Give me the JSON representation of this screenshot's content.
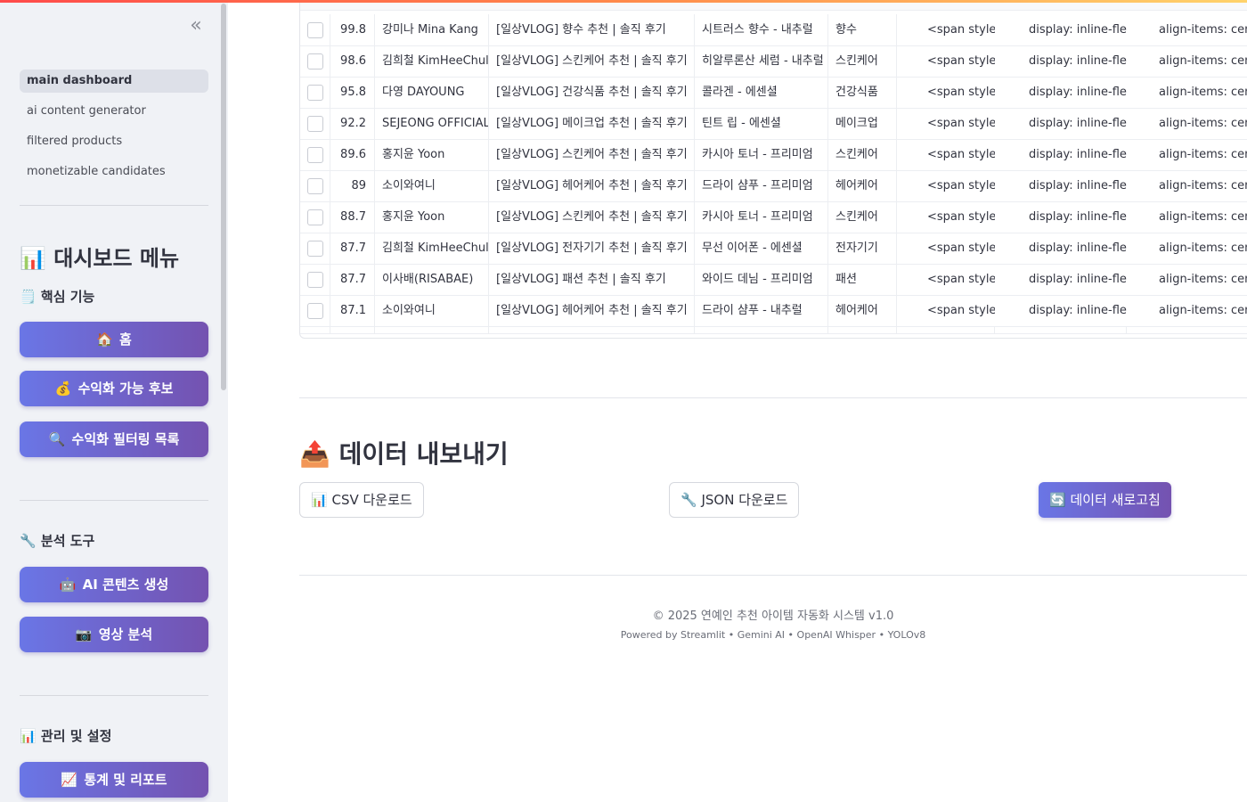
{
  "sidebar": {
    "collapse_icon": "«",
    "nav": [
      "main dashboard",
      "ai content generator",
      "filtered products",
      "monetizable candidates"
    ],
    "dashboard_menu_title": "대시보드 메뉴",
    "sections": {
      "core": "핵심 기능",
      "analysis": "분석 도구",
      "management": "관리 및 설정"
    },
    "buttons": {
      "home": "홈",
      "candidates": "수익화 가능 후보",
      "filtered": "수익화 필터링 목록",
      "ai_content": "AI 콘텐츠 생성",
      "video_analysis": "영상 분석",
      "stats": "통계 및 리포트"
    },
    "icons": {
      "chart": "📊",
      "clipboard": "🗒️",
      "home": "🏠",
      "money_bag": "💰",
      "magnifier": "🔍",
      "wrench": "🔧",
      "robot": "🤖",
      "camera": "📷",
      "chart_up": "📈"
    }
  },
  "table": {
    "rows": [
      {
        "score": "99.8",
        "channel": "강미나 Mina Kang",
        "title": "[일상VLOG] 향수 추천 | 솔직 후기",
        "product": "시트러스 향수 - 내추럴",
        "category": "향수",
        "c1": "<span style=\"",
        "c2": "display: inline-flex;",
        "c3": "align-items: center;"
      },
      {
        "score": "98.6",
        "channel": "김희철 KimHeeChul",
        "title": "[일상VLOG] 스킨케어 추천 | 솔직 후기",
        "product": "히알루론산 세럼 - 내추럴",
        "category": "스킨케어",
        "c1": "<span style=\"",
        "c2": "display: inline-flex;",
        "c3": "align-items: center;"
      },
      {
        "score": "95.8",
        "channel": "다영 DAYOUNG",
        "title": "[일상VLOG] 건강식품 추천 | 솔직 후기",
        "product": "콜라겐 - 에센셜",
        "category": "건강식품",
        "c1": "<span style=\"",
        "c2": "display: inline-flex;",
        "c3": "align-items: center;"
      },
      {
        "score": "92.2",
        "channel": "SEJEONG OFFICIAL",
        "title": "[일상VLOG] 메이크업 추천 | 솔직 후기",
        "product": "틴트 립 - 에센셜",
        "category": "메이크업",
        "c1": "<span style=\"",
        "c2": "display: inline-flex;",
        "c3": "align-items: center;"
      },
      {
        "score": "89.6",
        "channel": "홍지윤 Yoon",
        "title": "[일상VLOG] 스킨케어 추천 | 솔직 후기",
        "product": "카시아 토너 - 프리미엄",
        "category": "스킨케어",
        "c1": "<span style=\"",
        "c2": "display: inline-flex;",
        "c3": "align-items: center;"
      },
      {
        "score": "89",
        "channel": "소이와여니",
        "title": "[일상VLOG] 헤어케어 추천 | 솔직 후기",
        "product": "드라이 샴푸 - 프리미엄",
        "category": "헤어케어",
        "c1": "<span style=\"",
        "c2": "display: inline-flex;",
        "c3": "align-items: center;"
      },
      {
        "score": "88.7",
        "channel": "홍지윤 Yoon",
        "title": "[일상VLOG] 스킨케어 추천 | 솔직 후기",
        "product": "카시아 토너 - 프리미엄",
        "category": "스킨케어",
        "c1": "<span style=\"",
        "c2": "display: inline-flex;",
        "c3": "align-items: center;"
      },
      {
        "score": "87.7",
        "channel": "김희철 KimHeeChul",
        "title": "[일상VLOG] 전자기기 추천 | 솔직 후기",
        "product": "무선 이어폰 - 에센셜",
        "category": "전자기기",
        "c1": "<span style=\"",
        "c2": "display: inline-flex;",
        "c3": "align-items: center;"
      },
      {
        "score": "87.7",
        "channel": "이사배(RISABAE)",
        "title": "[일상VLOG] 패션 추천 | 솔직 후기",
        "product": "와이드 데님 - 프리미엄",
        "category": "패션",
        "c1": "<span style=\"",
        "c2": "display: inline-flex;",
        "c3": "align-items: center;"
      },
      {
        "score": "87.1",
        "channel": "소이와여니",
        "title": "[일상VLOG] 헤어케어 추천 | 솔직 후기",
        "product": "드라이 샴푸 - 내추럴",
        "category": "헤어케어",
        "c1": "<span style=\"",
        "c2": "display: inline-flex;",
        "c3": "align-items: center;"
      }
    ]
  },
  "export": {
    "title": "데이터 내보내기",
    "icon": "📤",
    "csv": "CSV 다운로드",
    "json": "JSON 다운로드",
    "refresh": "데이터 새로고침",
    "csv_icon": "📊",
    "json_icon": "🔧",
    "refresh_icon": "🔄"
  },
  "footer": {
    "copyright": "© 2025 연예인 추천 아이템 자동화 시스템 v1.0",
    "powered": "Powered by Streamlit • Gemini AI • OpenAI Whisper • YOLOv8"
  },
  "colors": {
    "accent_start": "#6a76e6",
    "accent_end": "#7452b0",
    "sidebar_bg": "#f0f2f6"
  }
}
